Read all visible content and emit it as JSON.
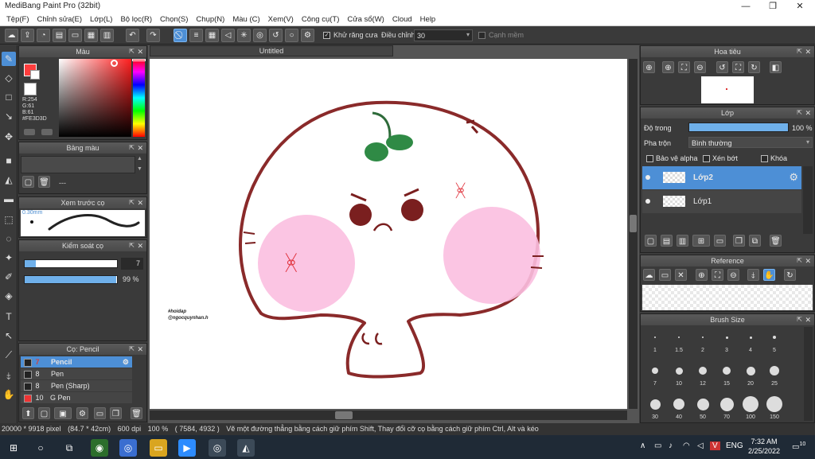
{
  "window": {
    "title": "MediBang Paint Pro (32bit)"
  },
  "menu": [
    "Tệp(F)",
    "Chỉnh sửa(E)",
    "Lớp(L)",
    "Bộ lọc(R)",
    "Chọn(S)",
    "Chụp(N)",
    "Màu (C)",
    "Xem(V)",
    "Công cụ(T)",
    "Cửa sổ(W)",
    "Cloud",
    "Help"
  ],
  "toolbar": {
    "antialias_label": "Khử răng cưa",
    "adjust_label": "Điều chỉnh",
    "adjust_value": "30",
    "edge_label": "Cạnh mềm"
  },
  "color_panel": {
    "title": "Màu",
    "r": "R:254",
    "g": "G:61",
    "b": "B:61",
    "hex": "#FE3D3D",
    "primary_color": "#fe3d3d",
    "secondary_color": "#ffffff"
  },
  "palette_panel": {
    "title": "Bảng màu",
    "placeholder": "---"
  },
  "brush_preview": {
    "title": "Xem trước cọ",
    "size": "0.30mm"
  },
  "brush_control": {
    "title": "Kiểm soát cọ",
    "size_value": "7",
    "opacity_value": "99 %"
  },
  "brush_list": {
    "title": "Cọ: Pencil",
    "items": [
      {
        "size": "7",
        "name": "Pencil",
        "selected": true
      },
      {
        "size": "8",
        "name": "Pen"
      },
      {
        "size": "8",
        "name": "Pen (Sharp)"
      },
      {
        "size": "10",
        "name": "G Pen"
      }
    ]
  },
  "document": {
    "tab": "Untitled"
  },
  "artwork": {
    "signature_line1": "#hoidap",
    "signature_line2": "@ngocquynhan.h"
  },
  "navigator": {
    "title": "Hoa tiêu"
  },
  "layers": {
    "title": "Lớp",
    "opacity_label": "Độ trong",
    "opacity_value": "100 %",
    "blend_label": "Pha trộn",
    "blend_value": "Bình thường",
    "protect_alpha": "Bảo vệ alpha",
    "clipping": "Xén bớt",
    "lock": "Khóa",
    "items": [
      {
        "name": "Lớp2",
        "selected": true
      },
      {
        "name": "Lớp1",
        "selected": false
      }
    ]
  },
  "reference": {
    "title": "Reference"
  },
  "brush_size": {
    "title": "Brush Size",
    "sizes": [
      "1",
      "1.5",
      "2",
      "3",
      "4",
      "5",
      "7",
      "10",
      "12",
      "15",
      "20",
      "25",
      "30",
      "40",
      "50",
      "70",
      "100",
      "150"
    ]
  },
  "statusbar": {
    "dims": "20000 * 9918 pixel",
    "physical": "(84.7 * 42cm)",
    "dpi": "600 dpi",
    "zoom": "100 %",
    "coords": "( 7584, 4932 )",
    "hint": "Vẽ một đường thẳng bằng cách giữ phím Shift, Thay đổi cỡ cọ bằng cách giữ phím Ctrl, Alt và kéo"
  },
  "taskbar": {
    "lang": "ENG",
    "time": "7:32 AM",
    "date": "2/25/2022",
    "notif_count": "10"
  }
}
